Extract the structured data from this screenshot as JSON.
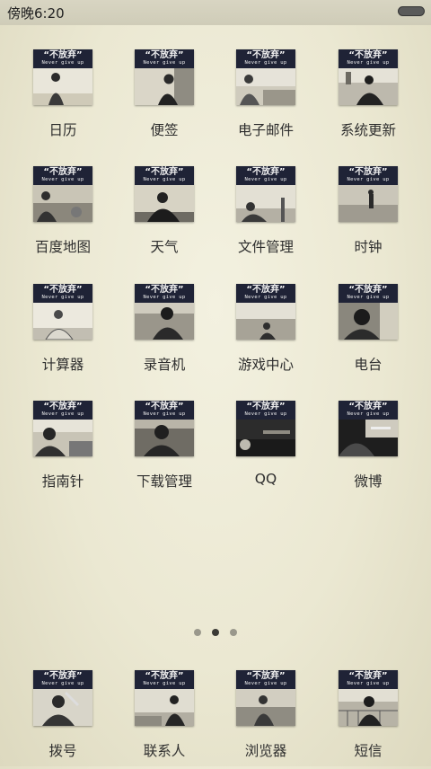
{
  "status_bar": {
    "time": "傍晚6:20",
    "battery_icon": "battery-icon"
  },
  "thumbnail": {
    "title": "“不放弃”",
    "subtitle": "Never give up"
  },
  "apps": [
    {
      "label": "日历"
    },
    {
      "label": "便签"
    },
    {
      "label": "电子邮件"
    },
    {
      "label": "系统更新"
    },
    {
      "label": "百度地图"
    },
    {
      "label": "天气"
    },
    {
      "label": "文件管理"
    },
    {
      "label": "时钟"
    },
    {
      "label": "计算器"
    },
    {
      "label": "录音机"
    },
    {
      "label": "游戏中心"
    },
    {
      "label": "电台"
    },
    {
      "label": "指南针"
    },
    {
      "label": "下载管理"
    },
    {
      "label": "QQ"
    },
    {
      "label": "微博"
    }
  ],
  "page_indicator": {
    "count": 3,
    "active": 2
  },
  "dock": [
    {
      "label": "拨号"
    },
    {
      "label": "联系人"
    },
    {
      "label": "浏览器"
    },
    {
      "label": "短信"
    }
  ],
  "colors": {
    "background": "#ebe8d2",
    "banner": "#1f2336",
    "label": "#2e2e2e"
  }
}
